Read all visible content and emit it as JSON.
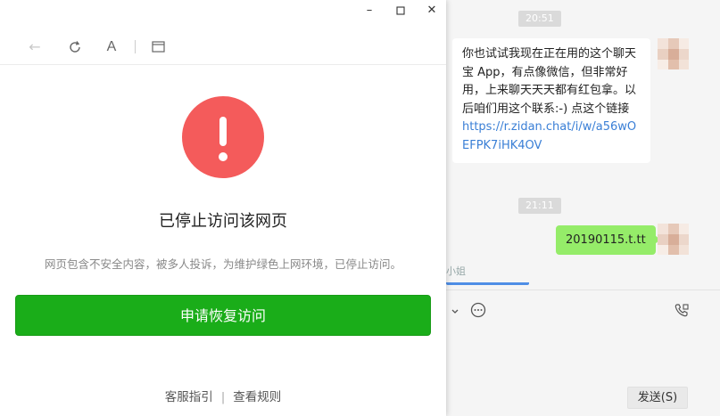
{
  "chat": {
    "time1": "20:51",
    "time2": "21:11",
    "incoming": {
      "text": "你也试试我现在正在用的这个聊天宝 App，有点像微信，但非常好用，上来聊天天天都有红包拿。以后咱们用这个联系:-) 点这个链接",
      "link": "https://r.zidan.chat/i/w/a56wOEFPK7iHK4OV"
    },
    "outgoing": {
      "text": "20190115.t.tt"
    },
    "sender_fragment": "小姐",
    "send_label": "发送(S)"
  },
  "popup": {
    "title": "已停止访问该网页",
    "description": "网页包含不安全内容，被多人投诉，为维护绿色上网环境，已停止访问。",
    "primary_button": "申请恢复访问",
    "footer": {
      "link1": "客服指引",
      "separator": "|",
      "link2": "查看规则"
    },
    "window_controls": {
      "minimize": "–",
      "maximize": "□",
      "close": "✕"
    },
    "toolbar": {
      "back": "←",
      "refresh": "⟳",
      "font": "A",
      "window": "▭"
    }
  },
  "colors": {
    "warning": "#f45b5b",
    "primary": "#1aad19",
    "outgoing_bubble": "#95ec69",
    "link": "#3a7fd6"
  }
}
